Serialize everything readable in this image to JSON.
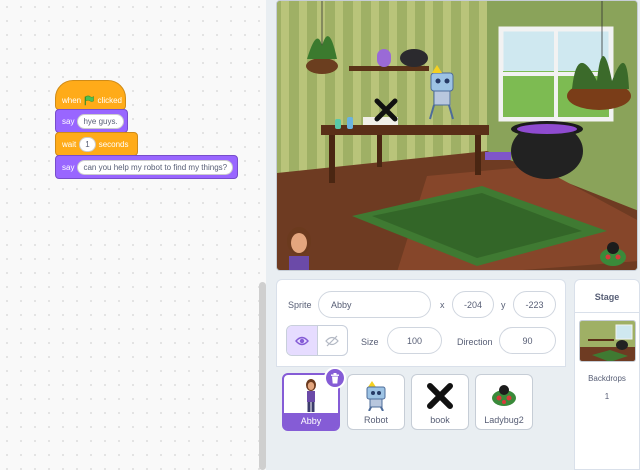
{
  "code": {
    "hat": {
      "label": "when",
      "suffix": "clicked"
    },
    "say1": {
      "label": "say",
      "value": "hye guys."
    },
    "wait": {
      "label": "wait",
      "value": "1",
      "suffix": "seconds"
    },
    "say2": {
      "label": "say",
      "value": "can you help my robot to find my things?"
    }
  },
  "sprite_info": {
    "sprite_label": "Sprite",
    "sprite_name": "Abby",
    "x_label": "x",
    "x_value": "-204",
    "y_label": "y",
    "y_value": "-223",
    "size_label": "Size",
    "size_value": "100",
    "direction_label": "Direction",
    "direction_value": "90"
  },
  "sprites": [
    {
      "name": "Abby",
      "icon": "abby-icon",
      "selected": true
    },
    {
      "name": "Robot",
      "icon": "robot-icon"
    },
    {
      "name": "book",
      "icon": "x-mark-icon"
    },
    {
      "name": "Ladybug2",
      "icon": "ladybug-icon"
    }
  ],
  "stage_panel": {
    "title": "Stage",
    "backdrops_label": "Backdrops",
    "backdrops_count": "1"
  },
  "colors": {
    "events": "#ffab19",
    "looks": "#9966ff",
    "selected": "#855cd6"
  }
}
